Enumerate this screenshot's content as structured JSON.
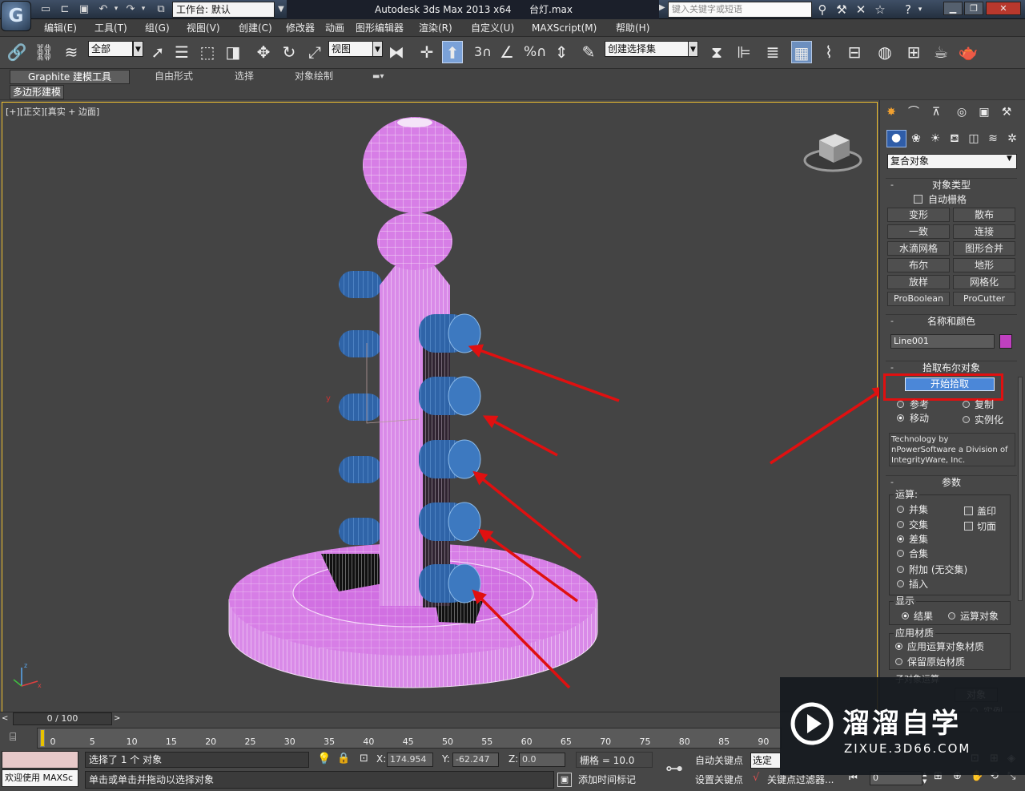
{
  "title_bar": {
    "app_logo_letter": "G",
    "workspace_label": "工作台: 默认",
    "app_title": "Autodesk 3ds Max  2013 x64",
    "file_name": "台灯.max",
    "search_placeholder": "键入关键字或短语"
  },
  "menu": [
    "编辑(E)",
    "工具(T)",
    "组(G)",
    "视图(V)",
    "创建(C)",
    "修改器",
    "动画",
    "图形编辑器",
    "渲染(R)",
    "自定义(U)",
    "MAXScript(M)",
    "帮助(H)"
  ],
  "toolbar": {
    "selection_filter": "全部",
    "reference_coord": "视图",
    "angle_snap_label": "3",
    "named_selection_set": "创建选择集"
  },
  "ribbon": {
    "tabs": [
      "Graphite 建模工具",
      "自由形式",
      "选择",
      "对象绘制"
    ],
    "active_sub_tab": "多边形建模"
  },
  "viewport": {
    "label_parts": [
      "[+]",
      "[正交]",
      "[真实 + 边面]"
    ]
  },
  "command_panel": {
    "category": "复合对象",
    "object_type": {
      "title": "对象类型",
      "autogrid": "自动栅格",
      "buttons": [
        "变形",
        "散布",
        "一致",
        "连接",
        "水滴网格",
        "图形合并",
        "布尔",
        "地形",
        "放样",
        "网格化",
        "ProBoolean",
        "ProCutter"
      ]
    },
    "name_color": {
      "title": "名称和颜色",
      "name": "Line001",
      "color": "#c040c0"
    },
    "pick_boolean": {
      "title": "拾取布尔对象",
      "pick_button": "开始拾取",
      "options": [
        "参考",
        "复制",
        "移动",
        "实例化"
      ],
      "selected_option": "移动",
      "credit": "Technology by nPowerSoftware a Division of IntegrityWare, Inc."
    },
    "parameters": {
      "title": "参数",
      "operation_label": "运算:",
      "operations": [
        "并集",
        "交集",
        "差集",
        "合集",
        "附加 (无交集)",
        "插入"
      ],
      "selected_operation": "差集",
      "checkboxes": [
        "盖印",
        "切面"
      ],
      "display_label": "显示",
      "display_options": [
        "结果",
        "运算对象"
      ],
      "display_selected": "结果",
      "material_label": "应用材质",
      "material_options": [
        "应用运算对象材质",
        "保留原始材质"
      ],
      "material_selected": "应用运算对象材质",
      "subobject_label": "子对象运算",
      "extract_label": "对象",
      "instance_label": "实例",
      "spinner_value": "0"
    }
  },
  "timeline": {
    "frame_display": "0 / 100",
    "ticks": [
      "0",
      "5",
      "10",
      "15",
      "20",
      "25",
      "30",
      "35",
      "40",
      "45",
      "50",
      "55",
      "60",
      "65",
      "70",
      "75",
      "80",
      "85",
      "90"
    ]
  },
  "status": {
    "welcome": "欢迎使用 MAXSc",
    "selected": "选择了 1 个 对象",
    "prompt": "单击或单击并拖动以选择对象",
    "x_label": "X:",
    "x_value": "174.954",
    "y_label": "Y:",
    "y_value": "-62.247",
    "z_label": "Z:",
    "z_value": "0.0",
    "grid": "栅格 = 10.0",
    "add_time_tag": "添加时间标记",
    "auto_key": "自动关键点",
    "set_key": "设置关键点",
    "selected_obj": "选定对",
    "key_filter": "关键点过滤器...",
    "frame_value": "0"
  },
  "watermark": {
    "brand": "溜溜自学",
    "url": "ZIXUE.3D66.COM"
  },
  "colors": {
    "object_magenta": "#d77ee6",
    "cylinder_blue": "#3d79c0",
    "annotation_red": "#e01010",
    "pick_button_blue": "#4b87d8"
  }
}
